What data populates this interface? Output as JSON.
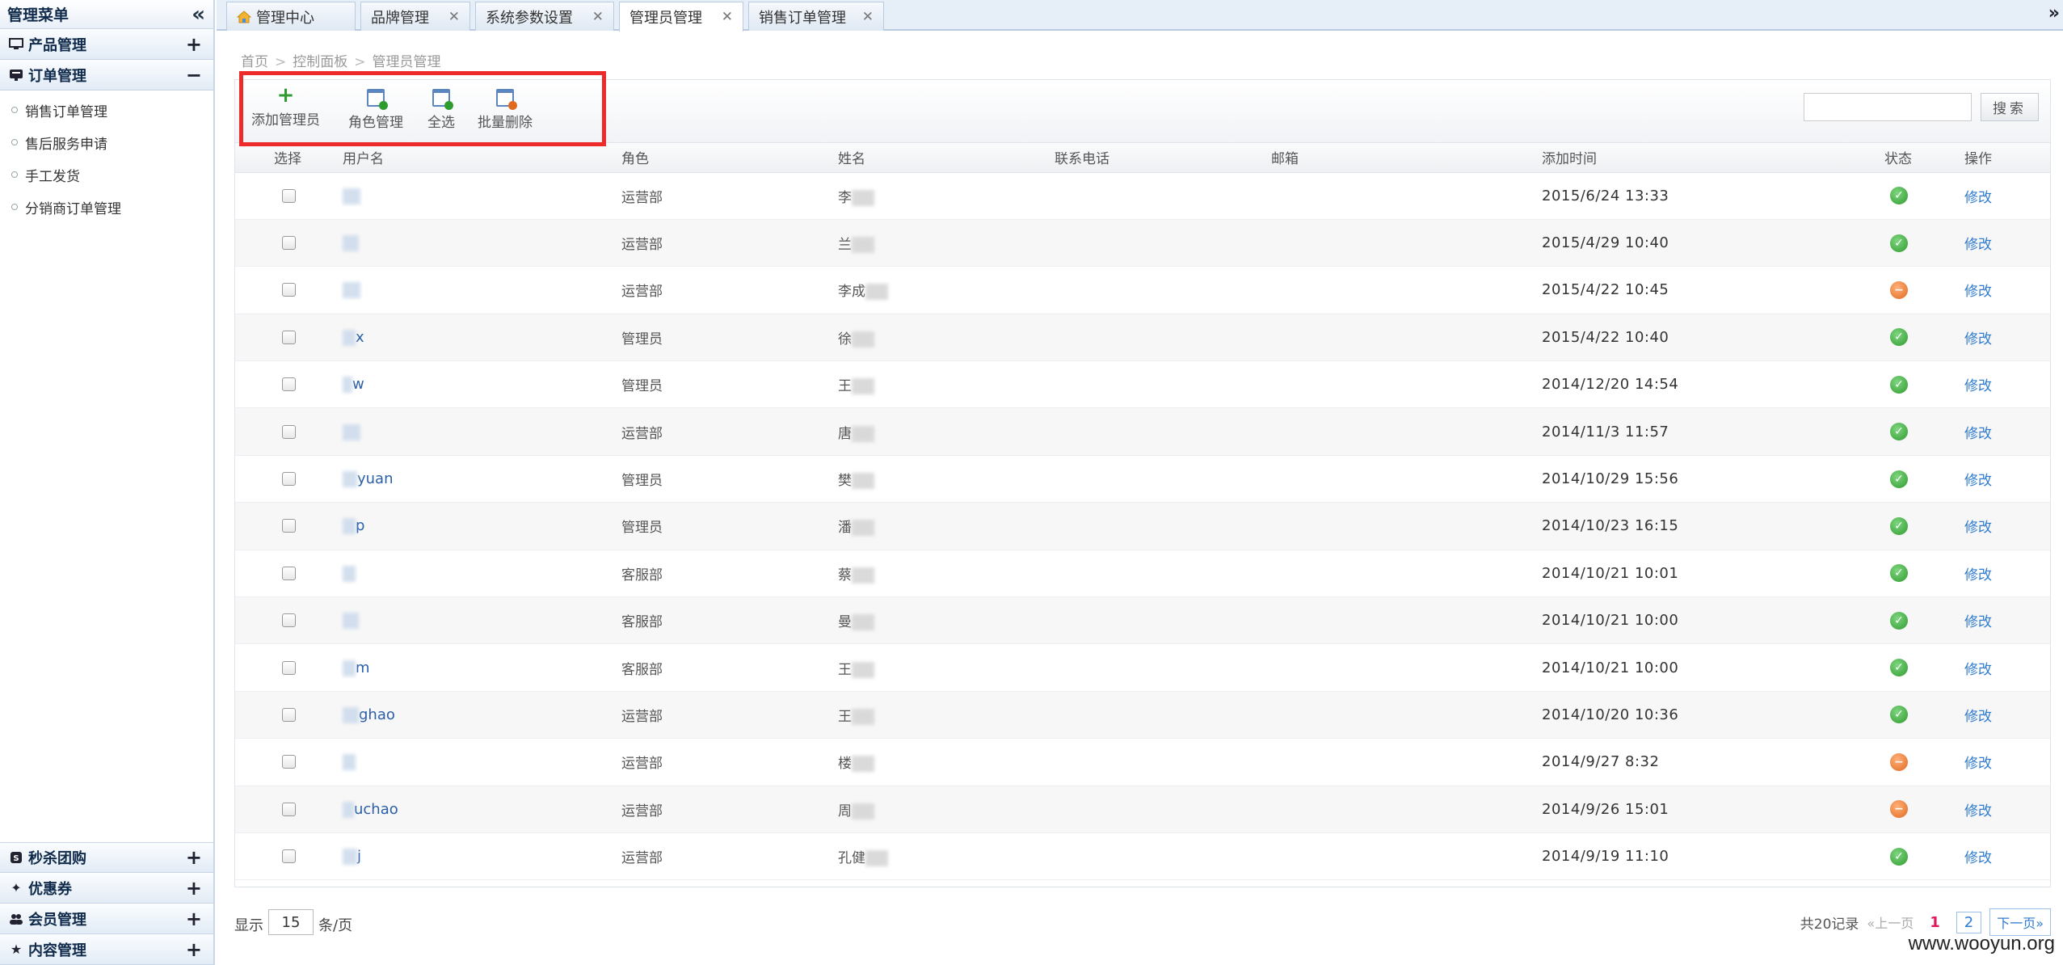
{
  "sidebar": {
    "title": "管理菜单",
    "groups_top": [
      {
        "label": "产品管理",
        "toggle": "+",
        "icon": "monitor-icon"
      },
      {
        "label": "订单管理",
        "toggle": "−",
        "icon": "order-icon"
      }
    ],
    "order_items": [
      "销售订单管理",
      "售后服务申请",
      "手工发货",
      "分销商订单管理"
    ],
    "groups_bottom": [
      {
        "label": "秒杀团购",
        "toggle": "+",
        "icon": "flash-sale-icon"
      },
      {
        "label": "优惠券",
        "toggle": "+",
        "icon": "coupon-icon"
      },
      {
        "label": "会员管理",
        "toggle": "+",
        "icon": "members-icon"
      },
      {
        "label": "内容管理",
        "toggle": "+",
        "icon": "star-icon"
      }
    ]
  },
  "tabs": [
    {
      "label": "管理中心",
      "closable": false
    },
    {
      "label": "品牌管理",
      "closable": true
    },
    {
      "label": "系统参数设置",
      "closable": true
    },
    {
      "label": "管理员管理",
      "closable": true,
      "active": true
    },
    {
      "label": "销售订单管理",
      "closable": true
    }
  ],
  "breadcrumb": [
    "首页",
    "控制面板",
    "管理员管理"
  ],
  "toolbar": {
    "add_admin": "添加管理员",
    "role_manage": "角色管理",
    "select_all": "全选",
    "batch_delete": "批量删除",
    "search_label": "搜索",
    "search_value": ""
  },
  "table": {
    "headers": [
      "选择",
      "用户名",
      "角色",
      "姓名",
      "联系电话",
      "邮箱",
      "添加时间",
      "状态",
      "操作"
    ],
    "rows": [
      {
        "user": "",
        "role": "运营部",
        "name": "李",
        "time": "2015/6/24 13:33",
        "status": "on",
        "op": "修改"
      },
      {
        "user": "",
        "role": "运营部",
        "name": "兰",
        "time": "2015/4/29 10:40",
        "status": "on",
        "op": "修改"
      },
      {
        "user": "",
        "role": "运营部",
        "name": "李成",
        "time": "2015/4/22 10:45",
        "status": "off",
        "op": "修改"
      },
      {
        "user": "x",
        "role": "管理员",
        "name": "徐",
        "time": "2015/4/22 10:40",
        "status": "on",
        "op": "修改"
      },
      {
        "user": "w",
        "role": "管理员",
        "name": "王",
        "time": "2014/12/20 14:54",
        "status": "on",
        "op": "修改"
      },
      {
        "user": "",
        "role": "运营部",
        "name": "唐",
        "time": "2014/11/3 11:57",
        "status": "on",
        "op": "修改"
      },
      {
        "user": "yuan",
        "role": "管理员",
        "name": "樊",
        "time": "2014/10/29 15:56",
        "status": "on",
        "op": "修改"
      },
      {
        "user": "p",
        "role": "管理员",
        "name": "潘",
        "time": "2014/10/23 16:15",
        "status": "on",
        "op": "修改"
      },
      {
        "user": "",
        "role": "客服部",
        "name": "蔡",
        "time": "2014/10/21 10:01",
        "status": "on",
        "op": "修改"
      },
      {
        "user": "",
        "role": "客服部",
        "name": "曼",
        "time": "2014/10/21 10:00",
        "status": "on",
        "op": "修改"
      },
      {
        "user": "m",
        "role": "客服部",
        "name": "王",
        "time": "2014/10/21 10:00",
        "status": "on",
        "op": "修改"
      },
      {
        "user": "ghao",
        "role": "运营部",
        "name": "王",
        "time": "2014/10/20 10:36",
        "status": "on",
        "op": "修改"
      },
      {
        "user": "",
        "role": "运营部",
        "name": "楼",
        "time": "2014/9/27 8:32",
        "status": "off",
        "op": "修改"
      },
      {
        "user": "uchao",
        "role": "运营部",
        "name": "周",
        "time": "2014/9/26 15:01",
        "status": "off",
        "op": "修改"
      },
      {
        "user": "j",
        "role": "运营部",
        "name": "孔健",
        "time": "2014/9/19 11:10",
        "status": "on",
        "op": "修改"
      }
    ]
  },
  "pagination": {
    "show_label": "显示",
    "per_page": "15",
    "per_page_suffix": "条/页",
    "total": "共20记录",
    "prev": "«上一页",
    "current": "1",
    "page2": "2",
    "next": "下一页»"
  },
  "watermark": "www.wooyun.org",
  "colors": {
    "accent_link": "#2f7bd0",
    "highlight_box": "#ee2b2b",
    "status_on": "#2f9a2f",
    "status_off": "#e06a20",
    "current_page": "#e2185b"
  }
}
